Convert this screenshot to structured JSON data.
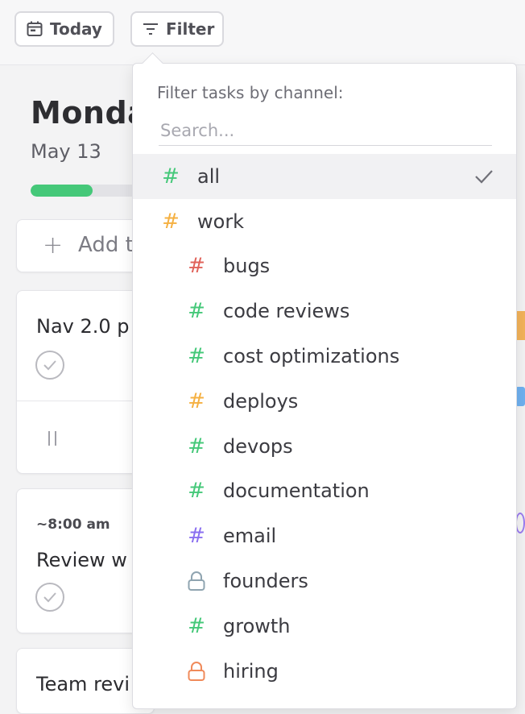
{
  "toolbar": {
    "today_label": "Today",
    "filter_label": "Filter"
  },
  "day": {
    "title": "Monda",
    "date": "May 13",
    "progress": 0.55
  },
  "add_task": {
    "label": "Add t"
  },
  "tasks": [
    {
      "title": "Nav 2.0 p"
    },
    {
      "time": "~8:00 am",
      "title": "Review w"
    },
    {
      "title": "Team revi"
    }
  ],
  "filter_menu": {
    "heading": "Filter tasks by channel:",
    "search_placeholder": "Search...",
    "items": [
      {
        "label": "all",
        "color": "#45c879",
        "icon": "hash-icon",
        "level": 0,
        "selected": true
      },
      {
        "label": "work",
        "color": "#f5b041",
        "icon": "hash-icon",
        "level": 0
      },
      {
        "label": "bugs",
        "color": "#e0625a",
        "icon": "hash-icon",
        "level": 1
      },
      {
        "label": "code reviews",
        "color": "#45c879",
        "icon": "hash-icon",
        "level": 1
      },
      {
        "label": "cost optimizations",
        "color": "#45c879",
        "icon": "hash-icon",
        "level": 1
      },
      {
        "label": "deploys",
        "color": "#f5b041",
        "icon": "hash-icon",
        "level": 1
      },
      {
        "label": "devops",
        "color": "#45c879",
        "icon": "hash-icon",
        "level": 1
      },
      {
        "label": "documentation",
        "color": "#45c879",
        "icon": "hash-icon",
        "level": 1
      },
      {
        "label": "email",
        "color": "#8a6ff0",
        "icon": "hash-icon",
        "level": 1
      },
      {
        "label": "founders",
        "color": "#8fa4b0",
        "icon": "lock-icon",
        "level": 1
      },
      {
        "label": "growth",
        "color": "#45c879",
        "icon": "hash-icon",
        "level": 1
      },
      {
        "label": "hiring",
        "color": "#f08a5a",
        "icon": "lock-icon",
        "level": 1
      }
    ]
  }
}
